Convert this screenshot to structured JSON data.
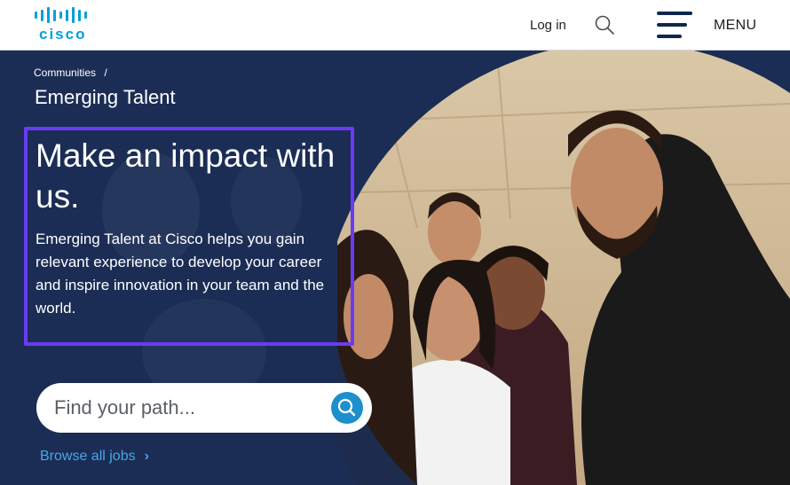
{
  "header": {
    "logo_text": "cisco",
    "login_label": "Log in",
    "menu_label": "MENU"
  },
  "hero": {
    "breadcrumb": {
      "parent": "Communities",
      "separator": "/"
    },
    "section_title": "Emerging Talent",
    "headline": "Make an impact with us.",
    "lead": "Emerging Talent at Cisco helps you gain relevant experience to develop your career and inspire innovation in your team and the world.",
    "search": {
      "placeholder": "Find your path..."
    },
    "browse_link": "Browse all jobs"
  },
  "icons": {
    "search": "search-icon",
    "menu": "hamburger-menu-icon",
    "chevron": "chevron-right-icon"
  },
  "colors": {
    "brand": "#049fd9",
    "hero_bg": "#1b2d55",
    "highlight_border": "#6a3bf5",
    "link": "#47a7e6",
    "search_button": "#1d8fcc"
  }
}
